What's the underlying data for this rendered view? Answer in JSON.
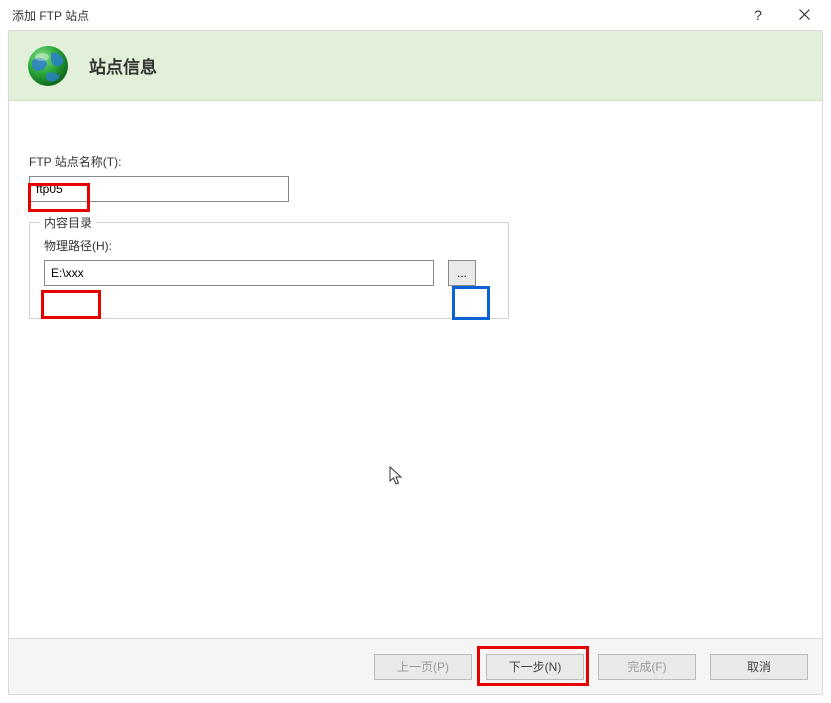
{
  "titlebar": {
    "title": "添加 FTP 站点",
    "help": "?",
    "close": "✕"
  },
  "header": {
    "title": "站点信息"
  },
  "form": {
    "sitename_label": "FTP 站点名称(T):",
    "sitename_value": "ftp05",
    "fieldset_legend": "内容目录",
    "physpath_label": "物理路径(H):",
    "physpath_value": "E:\\xxx",
    "browse_label": "..."
  },
  "footer": {
    "prev": "上一页(P)",
    "next": "下一步(N)",
    "finish": "完成(F)",
    "cancel": "取消"
  }
}
